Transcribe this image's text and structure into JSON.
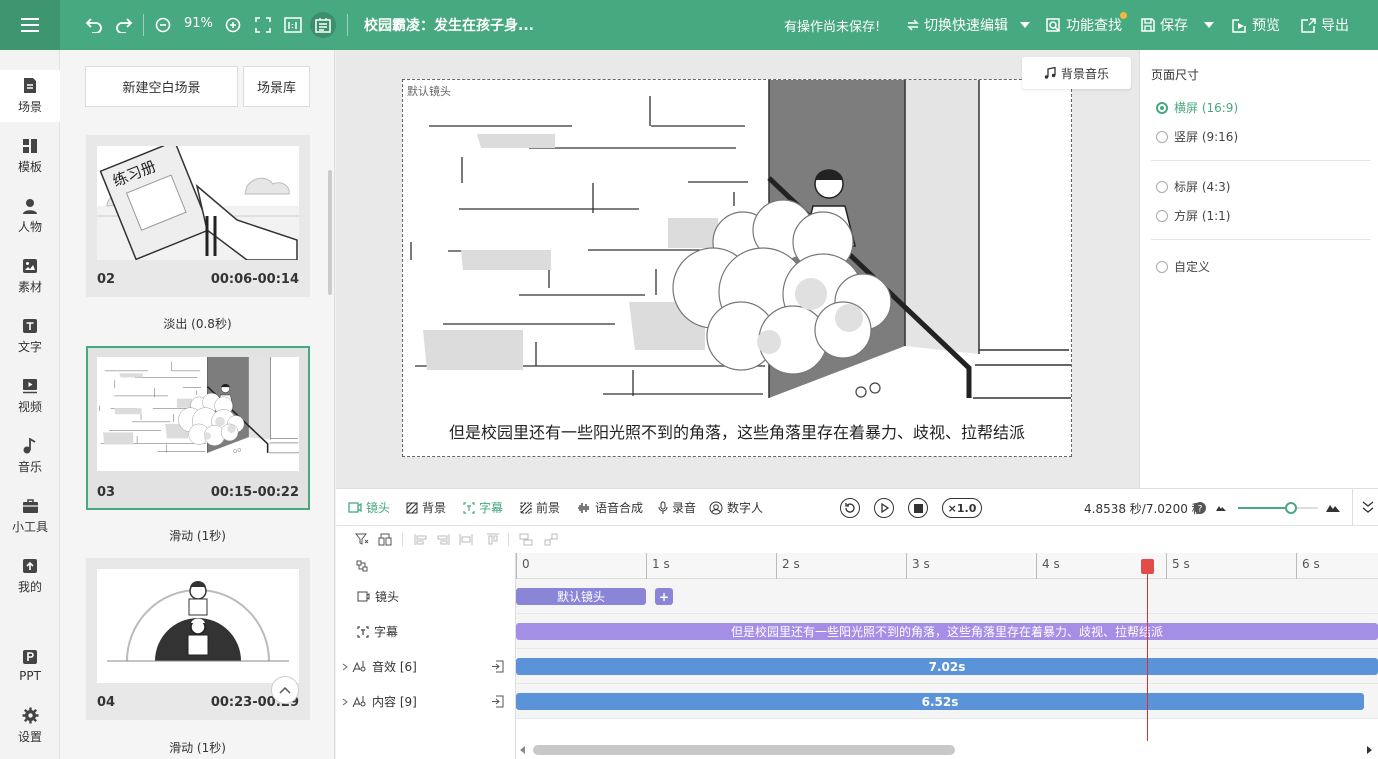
{
  "toolbar": {
    "zoom": "91%",
    "title": "校园霸凌：发生在孩子身...",
    "unsaved": "有操作尚未保存!",
    "switch_edit": "切换快速编辑",
    "func_search": "功能查找",
    "save": "保存",
    "preview": "预览",
    "export": "导出",
    "accent": "#47a97f"
  },
  "nav": {
    "items": [
      {
        "label": "场景",
        "icon": "scene-icon"
      },
      {
        "label": "模板",
        "icon": "template-icon"
      },
      {
        "label": "人物",
        "icon": "person-icon"
      },
      {
        "label": "素材",
        "icon": "material-icon"
      },
      {
        "label": "文字",
        "icon": "text-icon"
      },
      {
        "label": "视频",
        "icon": "video-icon"
      },
      {
        "label": "音乐",
        "icon": "music-icon"
      },
      {
        "label": "小工具",
        "icon": "toolbox-icon"
      },
      {
        "label": "我的",
        "icon": "upload-icon"
      },
      {
        "label": "PPT",
        "icon": "ppt-icon"
      },
      {
        "label": "设置",
        "icon": "gear-icon"
      }
    ]
  },
  "scenes": {
    "new_blank": "新建空白场景",
    "library": "场景库",
    "items": [
      {
        "num": "02",
        "time": "00:06-00:14",
        "transition": "淡出 (0.8秒)"
      },
      {
        "num": "03",
        "time": "00:15-00:22",
        "transition": "滑动 (1秒)"
      },
      {
        "num": "04",
        "time": "00:23-00:29",
        "transition": "滑动 (1秒)"
      }
    ],
    "book_text": "练习册"
  },
  "canvas": {
    "default_camera": "默认镜头",
    "subtitle": "但是校园里还有一些阳光照不到的角落，这些角落里存在着暴力、歧视、拉帮结派",
    "bgm": "背景音乐"
  },
  "page_size": {
    "title": "页面尺寸",
    "options": [
      {
        "label": "横屏 (16:9)",
        "selected": true
      },
      {
        "label": "竖屏 (9:16)",
        "selected": false
      },
      {
        "label": "标屏 (4:3)",
        "selected": false
      },
      {
        "label": "方屏 (1:1)",
        "selected": false
      },
      {
        "label": "自定义",
        "selected": false
      }
    ]
  },
  "timeline": {
    "tabs": [
      "镜头",
      "背景",
      "字幕",
      "前景",
      "语音合成",
      "录音",
      "数字人"
    ],
    "active_tab": "字幕",
    "speed": "×1.0",
    "time": "4.8538 秒/7.0200 秒",
    "playhead_seconds": 4.8538,
    "total_seconds": 7.02,
    "zoom_level": 0.66,
    "ruler": [
      "0",
      "1 s",
      "2 s",
      "3 s",
      "4 s",
      "5 s",
      "6 s"
    ],
    "rows": [
      {
        "label": "镜头",
        "icon": "camera-icon"
      },
      {
        "label": "字幕",
        "icon": "subtitle-icon"
      },
      {
        "label": "音效 [6]",
        "icon": "sound-effect-icon"
      },
      {
        "label": "内容 [9]",
        "icon": "content-icon"
      }
    ],
    "clips": {
      "camera": "默认镜头",
      "camera_add": "+",
      "subtitle": "但是校园里还有一些阳光照不到的角落，这些角落里存在着暴力、歧视、拉帮结派",
      "sound": "7.02s",
      "content": "6.52s"
    },
    "colors": {
      "camera_clip": "#8b85d8",
      "subtitle_clip": "#a58ee6",
      "audio_clip": "#5b93d9",
      "playhead": "#e02d2d"
    }
  }
}
